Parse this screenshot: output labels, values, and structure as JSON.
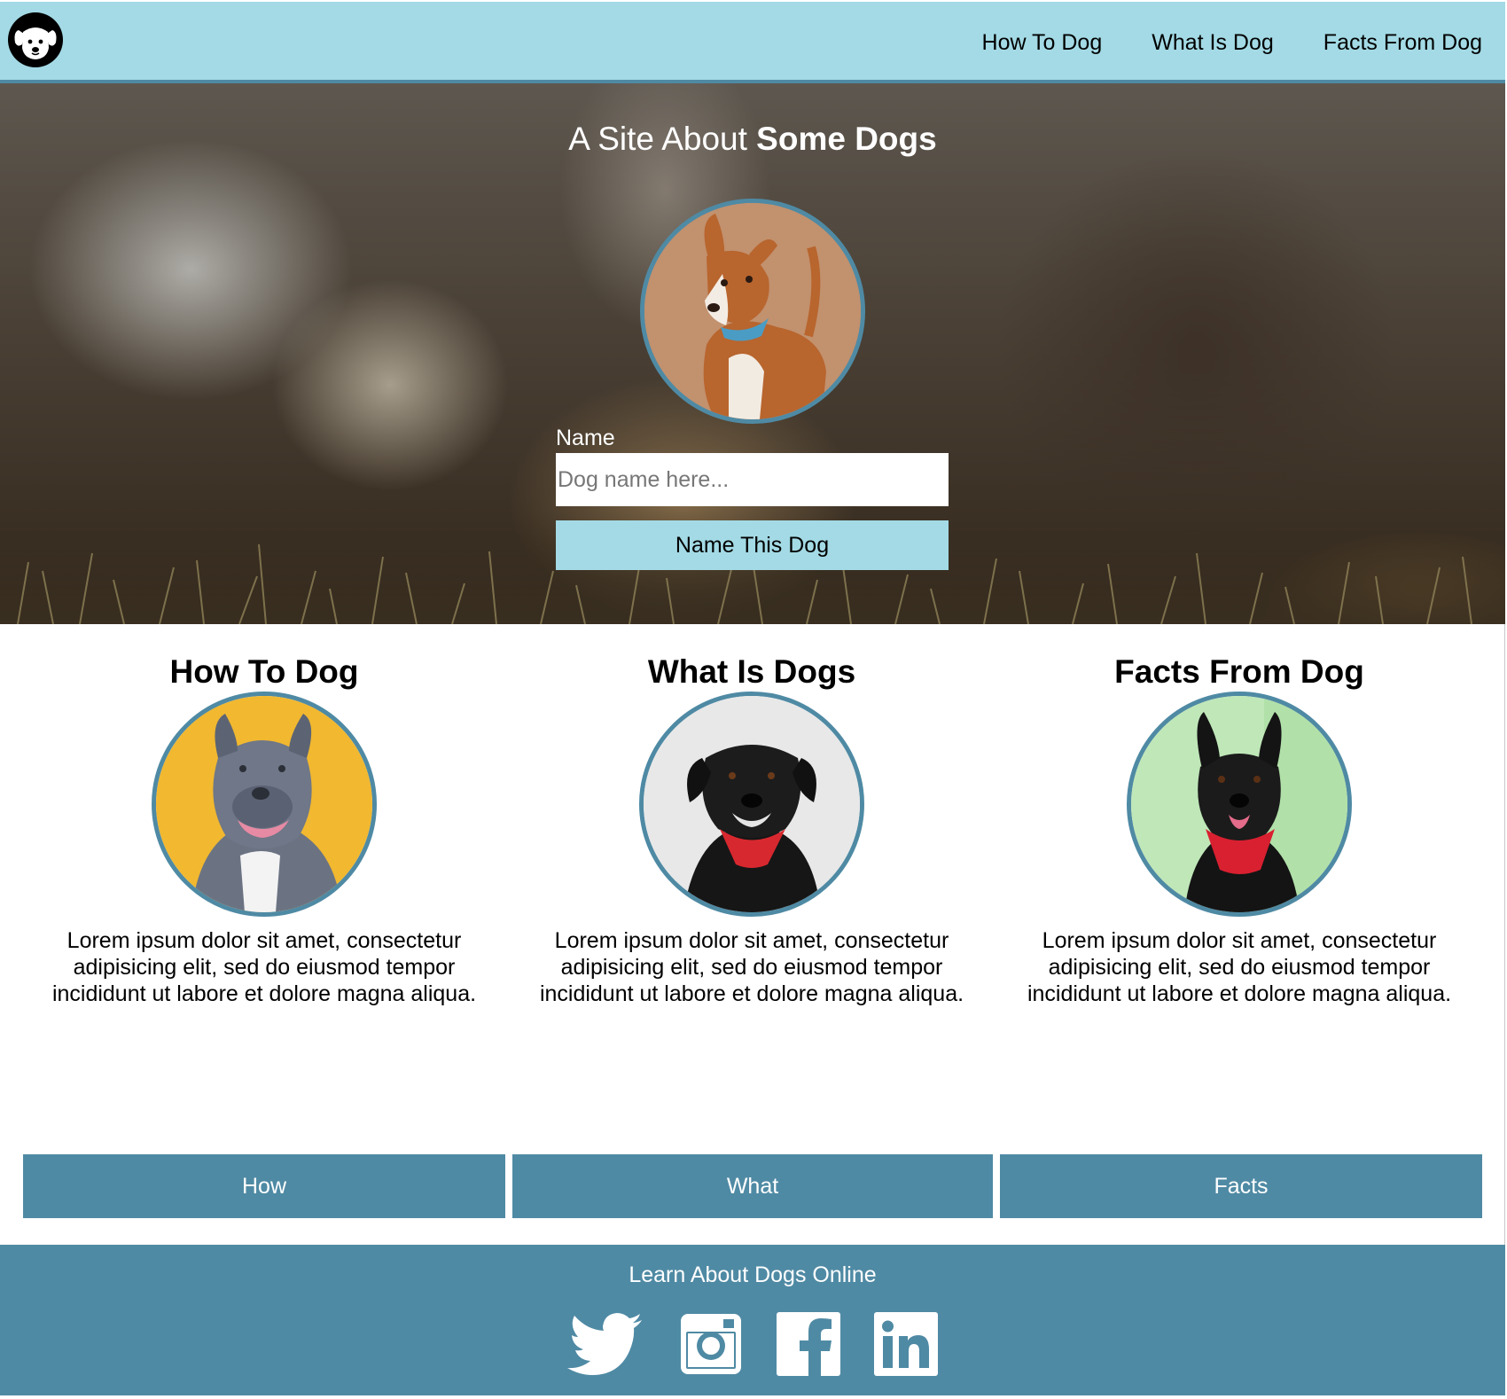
{
  "nav": {
    "logo": "dog-face-logo",
    "links": [
      {
        "label": "How To Dog"
      },
      {
        "label": "What Is Dog"
      },
      {
        "label": "Facts From Dog"
      }
    ]
  },
  "hero": {
    "title_prefix": "A Site About ",
    "title_bold": "Some Dogs",
    "form": {
      "label": "Name",
      "placeholder": "Dog name here...",
      "value": "",
      "button_label": "Name This Dog"
    }
  },
  "features": [
    {
      "title": "How To Dog",
      "text": "Lorem ipsum dolor sit amet, consectetur adipisicing elit, sed do eiusmod tempor incididunt ut labore et dolore magna aliqua."
    },
    {
      "title": "What Is Dogs",
      "text": "Lorem ipsum dolor sit amet, consectetur adipisicing elit, sed do eiusmod tempor incididunt ut labore et dolore magna aliqua."
    },
    {
      "title": "Facts From Dog",
      "text": "Lorem ipsum dolor sit amet, consectetur adipisicing elit, sed do eiusmod tempor incididunt ut labore et dolore magna aliqua."
    }
  ],
  "cta_buttons": [
    {
      "label": "How"
    },
    {
      "label": "What"
    },
    {
      "label": "Facts"
    }
  ],
  "footer": {
    "text": "Learn About Dogs Online",
    "social_icons": [
      "twitter-icon",
      "instagram-icon",
      "facebook-icon",
      "linkedin-icon"
    ]
  },
  "colors": {
    "nav_bg": "#a3dae5",
    "accent": "#4f8aa4",
    "button_light": "#a3dae5",
    "white": "#ffffff"
  }
}
